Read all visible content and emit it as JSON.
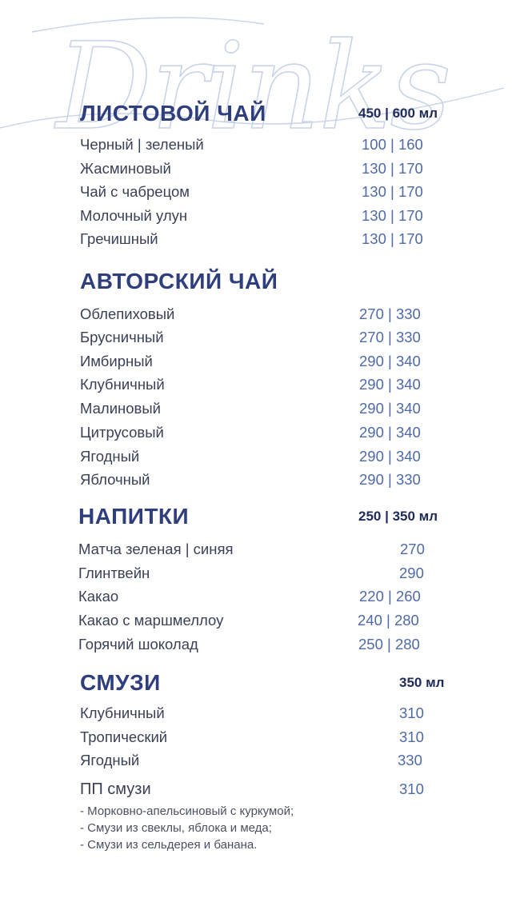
{
  "watermark": {
    "text": "Drinks"
  },
  "sections": [
    {
      "title": "ЛИСТОВОЙ ЧАЙ",
      "unit": "450 | 600 мл",
      "items": [
        {
          "name": "Черный | зеленый",
          "price": "100 | 160"
        },
        {
          "name": "Жасминовый",
          "price": "130 | 170"
        },
        {
          "name": "Чай с чабрецом",
          "price": "130 | 170"
        },
        {
          "name": "Молочный улун",
          "price": "130 | 170"
        },
        {
          "name": "Гречишный",
          "price": "130 | 170"
        }
      ]
    },
    {
      "title": "АВТОРСКИЙ ЧАЙ",
      "unit": "",
      "items": [
        {
          "name": "Облепиховый",
          "price": "270 | 330"
        },
        {
          "name": "Брусничный",
          "price": "270 | 330"
        },
        {
          "name": "Имбирный",
          "price": "290 | 340"
        },
        {
          "name": "Клубничный",
          "price": "290 | 340"
        },
        {
          "name": "Малиновый",
          "price": "290 | 340"
        },
        {
          "name": "Цитрусовый",
          "price": "290 | 340"
        },
        {
          "name": "Ягодный",
          "price": "290 | 340"
        },
        {
          "name": "Яблочный",
          "price": "290 | 330"
        }
      ]
    },
    {
      "title": "НАПИТКИ",
      "unit": "250 | 350 мл",
      "items": [
        {
          "name": "Матча зеленая | синяя",
          "price": "270"
        },
        {
          "name": "Глинтвейн",
          "price": "290"
        },
        {
          "name": "Какао",
          "price": "220 | 260"
        },
        {
          "name": "Какао с маршмеллоу",
          "price": "240 | 280"
        },
        {
          "name": "Горячий шоколад",
          "price": "250 | 280"
        }
      ]
    },
    {
      "title": "СМУЗИ",
      "unit": "350 мл",
      "items": [
        {
          "name": "Клубничный",
          "price": "310"
        },
        {
          "name": "Тропический",
          "price": "310"
        },
        {
          "name": "Ягодный",
          "price": "330"
        },
        {
          "name": "ПП смузи",
          "price": "310"
        }
      ]
    }
  ],
  "notes": [
    "- Морковно-апельсиновый  с куркумой;",
    "- Смузи из свеклы, яблока и меда;",
    "- Смузи из сельдерея и банана."
  ]
}
